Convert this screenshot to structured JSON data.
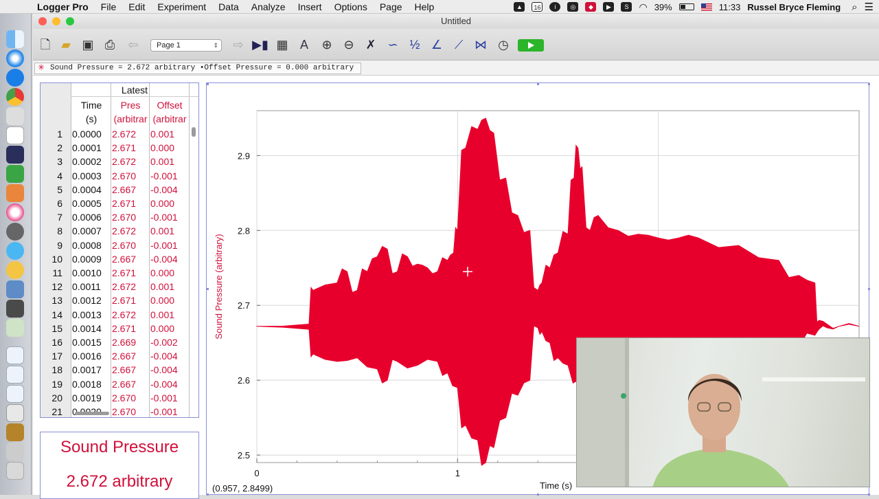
{
  "menubar": {
    "app_name": "Logger Pro",
    "menus": [
      "File",
      "Edit",
      "Experiment",
      "Data",
      "Analyze",
      "Insert",
      "Options",
      "Page",
      "Help"
    ],
    "calendar_day": "16",
    "battery": "39%",
    "clock": "11:33",
    "user": "Russel Bryce Fleming"
  },
  "window": {
    "title": "Untitled",
    "page_select": "Page 1"
  },
  "meter_bar": {
    "text": "Sound Pressure = 2.672 arbitrary •Offset Pressure = 0.000 arbitrary"
  },
  "table": {
    "group_header": "Latest",
    "columns": [
      {
        "name": "Time",
        "unit": "(s)"
      },
      {
        "name": "Pres",
        "unit": "(arbitrar"
      },
      {
        "name": "Offset",
        "unit": "(arbitrar"
      }
    ],
    "rows": [
      [
        "1",
        "0.0000",
        "2.672",
        "0.001"
      ],
      [
        "2",
        "0.0001",
        "2.671",
        "0.000"
      ],
      [
        "3",
        "0.0002",
        "2.672",
        "0.001"
      ],
      [
        "4",
        "0.0003",
        "2.670",
        "-0.001"
      ],
      [
        "5",
        "0.0004",
        "2.667",
        "-0.004"
      ],
      [
        "6",
        "0.0005",
        "2.671",
        "0.000"
      ],
      [
        "7",
        "0.0006",
        "2.670",
        "-0.001"
      ],
      [
        "8",
        "0.0007",
        "2.672",
        "0.001"
      ],
      [
        "9",
        "0.0008",
        "2.670",
        "-0.001"
      ],
      [
        "10",
        "0.0009",
        "2.667",
        "-0.004"
      ],
      [
        "11",
        "0.0010",
        "2.671",
        "0.000"
      ],
      [
        "12",
        "0.0011",
        "2.672",
        "0.001"
      ],
      [
        "13",
        "0.0012",
        "2.671",
        "0.000"
      ],
      [
        "14",
        "0.0013",
        "2.672",
        "0.001"
      ],
      [
        "15",
        "0.0014",
        "2.671",
        "0.000"
      ],
      [
        "16",
        "0.0015",
        "2.669",
        "-0.002"
      ],
      [
        "17",
        "0.0016",
        "2.667",
        "-0.004"
      ],
      [
        "18",
        "0.0017",
        "2.667",
        "-0.004"
      ],
      [
        "19",
        "0.0018",
        "2.667",
        "-0.004"
      ],
      [
        "20",
        "0.0019",
        "2.670",
        "-0.001"
      ],
      [
        "21",
        "0.0020",
        "2.670",
        "-0.001"
      ]
    ]
  },
  "meter_panel": {
    "title": "Sound Pressure",
    "value": "2.672 arbitrary"
  },
  "graph": {
    "coord_readout": "(0.957, 2.8499)",
    "line_color": "#e8002d"
  },
  "chart_data": {
    "type": "area",
    "title": "",
    "xlabel": "Time (s)",
    "ylabel": "Sound Pressure (arbitrary)",
    "xlim": [
      0,
      3
    ],
    "ylim": [
      2.49,
      2.96
    ],
    "x_ticks": [
      0,
      1
    ],
    "y_ticks": [
      2.5,
      2.6,
      2.7,
      2.8,
      2.9
    ],
    "grid": true,
    "series": [
      {
        "upper": {
          "x": [
            0,
            0.26,
            0.28,
            0.4,
            0.45,
            0.5,
            0.55,
            0.6,
            0.65,
            0.7,
            0.75,
            0.8,
            0.85,
            0.9,
            0.95,
            0.98,
            1.0,
            1.04,
            1.1,
            1.14,
            1.18,
            1.24,
            1.3,
            1.36,
            1.4,
            1.42,
            1.46,
            1.5,
            1.55,
            1.58,
            1.6,
            1.62,
            1.66,
            1.7,
            1.8,
            1.9,
            2.0,
            2.1,
            2.2,
            2.4,
            2.6,
            2.7,
            2.78,
            2.8,
            2.84,
            2.9,
            3.0
          ],
          "y": [
            2.672,
            2.675,
            2.72,
            2.73,
            2.745,
            2.72,
            2.745,
            2.765,
            2.775,
            2.745,
            2.765,
            2.755,
            2.75,
            2.745,
            2.76,
            2.77,
            2.8,
            2.91,
            2.935,
            2.95,
            2.93,
            2.87,
            2.82,
            2.8,
            2.72,
            2.73,
            2.75,
            2.77,
            2.795,
            2.87,
            2.91,
            2.885,
            2.8,
            2.82,
            2.8,
            2.795,
            2.79,
            2.79,
            2.79,
            2.78,
            2.76,
            2.74,
            2.73,
            2.68,
            2.675,
            2.672,
            2.672
          ]
        },
        "lower": {
          "x": [
            0,
            0.26,
            0.28,
            0.4,
            0.5,
            0.6,
            0.65,
            0.7,
            0.8,
            0.9,
            0.95,
            1.0,
            1.04,
            1.1,
            1.14,
            1.18,
            1.24,
            1.3,
            1.36,
            1.4,
            1.42,
            1.46,
            1.5,
            1.55,
            1.6,
            1.66,
            1.7,
            1.8,
            1.9,
            2.0,
            2.1,
            2.2,
            2.4,
            2.6,
            2.7,
            2.78,
            2.8,
            2.84,
            2.9,
            3.0
          ],
          "y": [
            2.672,
            2.668,
            2.635,
            2.625,
            2.63,
            2.615,
            2.6,
            2.625,
            2.62,
            2.625,
            2.61,
            2.59,
            2.54,
            2.52,
            2.49,
            2.51,
            2.55,
            2.58,
            2.6,
            2.67,
            2.665,
            2.65,
            2.63,
            2.62,
            2.6,
            2.6,
            2.6,
            2.61,
            2.61,
            2.615,
            2.615,
            2.62,
            2.62,
            2.635,
            2.645,
            2.66,
            2.668,
            2.67,
            2.672,
            2.672
          ]
        }
      }
    ]
  }
}
